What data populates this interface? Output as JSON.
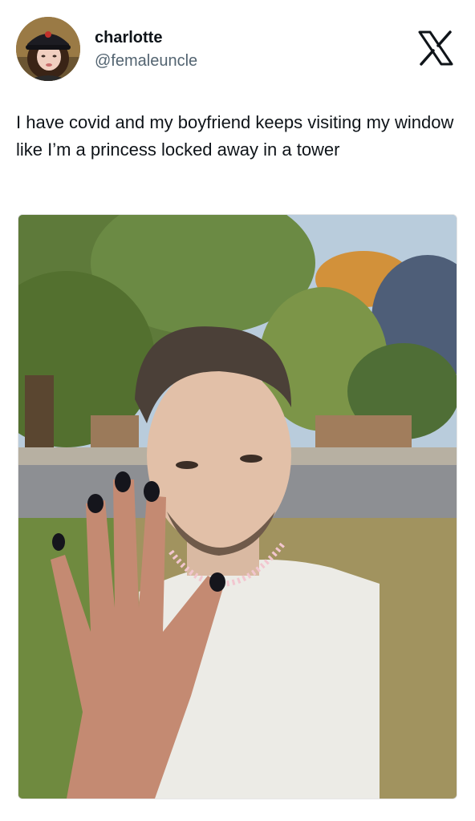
{
  "author": {
    "display_name": "charlotte",
    "handle": "@femaleuncle",
    "avatar_icon": "profile-photo"
  },
  "platform": {
    "logo_icon": "x-logo-icon"
  },
  "tweet": {
    "text": "I have covid and my boyfriend keeps visiting my window like I’m a princess locked away in a tower"
  },
  "media": {
    "type": "photo"
  },
  "colors": {
    "text_primary": "#0f1419",
    "text_secondary": "#536471",
    "background": "#ffffff"
  }
}
